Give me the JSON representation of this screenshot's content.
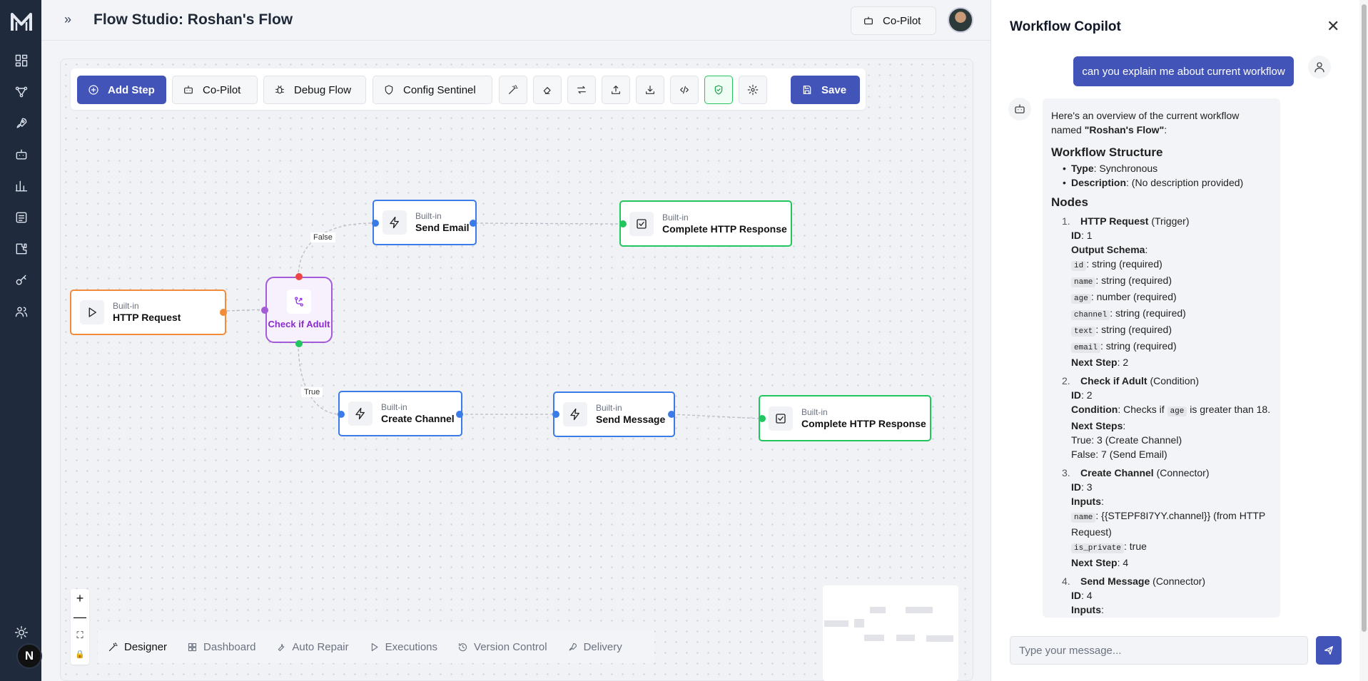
{
  "header": {
    "title": "Flow Studio: Roshan's Flow",
    "copilot_label": "Co-Pilot"
  },
  "rail": {
    "icons": [
      "dashboard-icon",
      "flow-icon",
      "rocket-icon",
      "bot-icon",
      "chart-icon",
      "docs-icon",
      "puzzle-icon",
      "key-icon",
      "users-icon",
      "sun-icon",
      "settings-icon"
    ],
    "avatar_letter": "N"
  },
  "toolbar": {
    "add_step": "Add Step",
    "copilot": "Co-Pilot",
    "debug": "Debug Flow",
    "sentinel": "Config Sentinel",
    "save": "Save",
    "icon_buttons": [
      "magic-wand-icon",
      "eraser-icon",
      "swap-icon",
      "upload-icon",
      "download-icon",
      "code-icon",
      "shield-check-icon",
      "gear-icon"
    ]
  },
  "nodes": {
    "http_request": {
      "sub": "Built-in",
      "name": "HTTP Request"
    },
    "check_adult": {
      "name": "Check if Adult"
    },
    "send_email": {
      "sub": "Built-in",
      "name": "Send Email"
    },
    "complete_1": {
      "sub": "Built-in",
      "name": "Complete HTTP Response"
    },
    "create_channel": {
      "sub": "Built-in",
      "name": "Create Channel"
    },
    "send_message": {
      "sub": "Built-in",
      "name": "Send Message"
    },
    "complete_2": {
      "sub": "Built-in",
      "name": "Complete HTTP Response"
    }
  },
  "edges": {
    "false_label": "False",
    "true_label": "True"
  },
  "zoom": {
    "in": "+",
    "out": "—",
    "fit": "⛶",
    "lock": "🔒"
  },
  "tabs": [
    {
      "label": "Designer",
      "icon": "wand-icon",
      "active": true
    },
    {
      "label": "Dashboard",
      "icon": "grid-icon"
    },
    {
      "label": "Auto Repair",
      "icon": "wrench-icon"
    },
    {
      "label": "Executions",
      "icon": "play-icon"
    },
    {
      "label": "Version Control",
      "icon": "history-icon"
    },
    {
      "label": "Delivery",
      "icon": "rocket-icon"
    }
  ],
  "copilot": {
    "title": "Workflow Copilot",
    "user_message": "can you explain me about current workflow",
    "input_placeholder": "Type your message...",
    "intro": "Here's an overview of the current workflow named ",
    "intro_name": "\"Roshan's Flow\"",
    "intro_end": ":",
    "structure_heading": "Workflow Structure",
    "type_label": "Type",
    "type_value": ": Synchronous",
    "desc_label": "Description",
    "desc_value": ": (No description provided)",
    "nodes_heading": "Nodes",
    "n1": {
      "num": "1.",
      "name": "HTTP Request",
      "kind": " (Trigger)",
      "id_label": "ID",
      "id_value": ": 1",
      "schema_label": "Output Schema",
      "schema_colon": ":",
      "fields": [
        {
          "code": "id",
          "text": ": string (required)"
        },
        {
          "code": "name",
          "text": ": string (required)"
        },
        {
          "code": "age",
          "text": ": number (required)"
        },
        {
          "code": "channel",
          "text": ": string (required)"
        },
        {
          "code": "text",
          "text": ": string (required)"
        },
        {
          "code": "email",
          "text": ": string (required)"
        }
      ],
      "next_label": "Next Step",
      "next_value": ": 2"
    },
    "n2": {
      "num": "2.",
      "name": "Check if Adult",
      "kind": " (Condition)",
      "id_label": "ID",
      "id_value": ": 2",
      "cond_label": "Condition",
      "cond_pre": ": Checks if ",
      "cond_code": "age",
      "cond_post": " is greater than 18.",
      "next_label": "Next Steps",
      "next_colon": ":",
      "true_text": "True: 3 (Create Channel)",
      "false_text": "False: 7 (Send Email)"
    },
    "n3": {
      "num": "3.",
      "name": "Create Channel",
      "kind": " (Connector)",
      "id_label": "ID",
      "id_value": ": 3",
      "inputs_label": "Inputs",
      "inputs_colon": ":",
      "in1_code": "name",
      "in1_text": ": {{STEPF8I7YY.channel}} (from HTTP Request)",
      "in2_code": "is_private",
      "in2_text": ": true",
      "next_label": "Next Step",
      "next_value": ": 4"
    },
    "n4": {
      "num": "4.",
      "name": "Send Message",
      "kind": " (Connector)",
      "id_label": "ID",
      "id_value": ": 4",
      "inputs_label": "Inputs",
      "inputs_colon": ":"
    }
  }
}
